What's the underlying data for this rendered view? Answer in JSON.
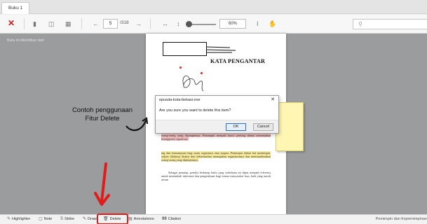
{
  "tab": {
    "label": "Buku 1"
  },
  "toolbar": {
    "page_current": "5",
    "page_total": "/318",
    "zoom": "60%",
    "search_placeholder": ""
  },
  "workspace": {
    "publisher_note": "Buku ini diterbitkan oleh"
  },
  "page": {
    "title": "KATA PENGANTAR",
    "paragraph_1": "kuning pemimpin dalam menjalankan peran kepemimpinannya. bepetit kita ketahui bersama, bahwa pemimpin memainkan peran dalam memberikan nilai tambah dan masa depan kepada orang-orang yang dipimpinnya. Pemimpin menjadi kunci penting dalam menentukan keunggulan organisasi.",
    "paragraph_1b": "ing dan kemampuan bagi suatu organisasi atau negara. Pemimpin dalam hal memimpin, sukses tidaknya diukur dari keberhasilan memajukan organisasinya dan mensejahterakan orang-orang yang dipimpinnya.",
    "paragraph_2": "Sebagai penutup, penulis berharap buku yang sederhana ini dapat menjadi referensi untuk menambah informasi dan pengetahuan bagi semua masyarakat luas, baik yang masih awam"
  },
  "dialog": {
    "title": "epusda-kota-bekasi.exe",
    "message": "Are you sure you want to delete this item?",
    "ok_label": "OK",
    "cancel_label": "Cancel",
    "close_glyph": "✕"
  },
  "annotation": {
    "caption_line1": "Contoh penggunaan",
    "caption_line2": "Fitur Delete"
  },
  "bottom": {
    "items": [
      {
        "icon": "✎",
        "label": "Highlighter"
      },
      {
        "icon": "▢",
        "label": "Note"
      },
      {
        "icon": "S",
        "label": "Strike"
      },
      {
        "icon": "✎",
        "label": "Draw"
      },
      {
        "icon": "🗑",
        "label": "Delete"
      },
      {
        "icon": "▤",
        "label": "Annotations"
      },
      {
        "icon": "99",
        "label": "Citation"
      }
    ],
    "right_text": "Pemimpin dan Kepemimpinan"
  },
  "colors": {
    "accent_red": "#e01d1d",
    "highlight_yellow": "#f6e99b",
    "highlight_red": "#f4c1c1"
  }
}
